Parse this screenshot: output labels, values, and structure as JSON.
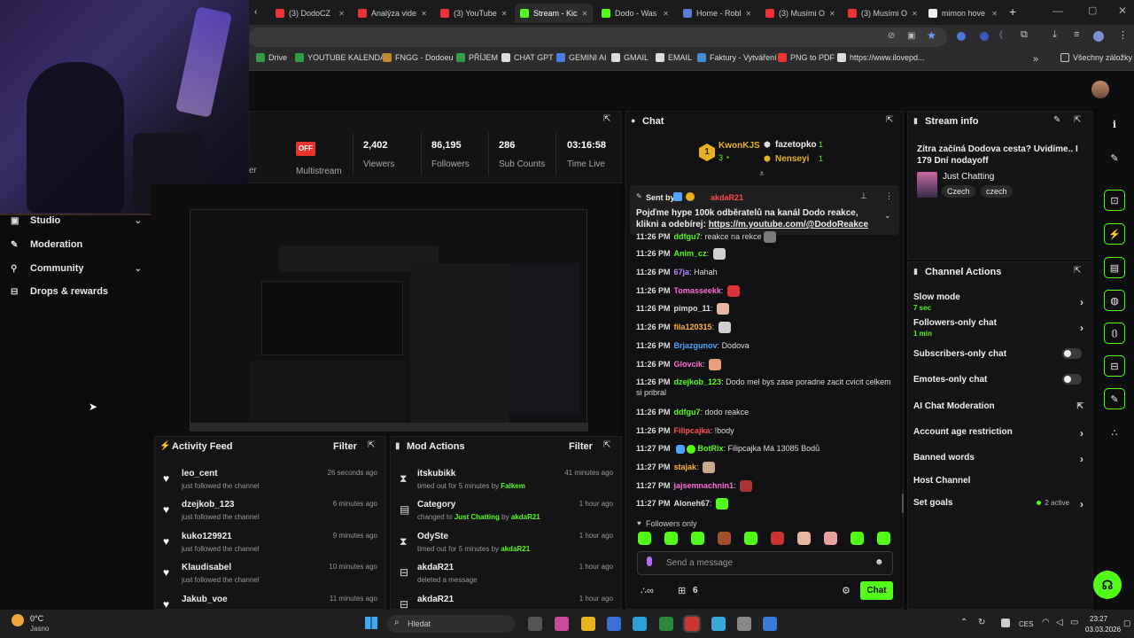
{
  "browser": {
    "tabs": [
      {
        "label": "(3) DodoCZ",
        "color": "#e33"
      },
      {
        "label": "Analýza vide",
        "color": "#e33"
      },
      {
        "label": "(3) YouTube",
        "color": "#e33"
      },
      {
        "label": "Stream - Kic",
        "color": "#53fc18",
        "active": true
      },
      {
        "label": "Dodo - Was",
        "color": "#53fc18"
      },
      {
        "label": "Home - Robl",
        "color": "#5b7bd5"
      },
      {
        "label": "(3) Musími O",
        "color": "#e33"
      },
      {
        "label": "(3) Musími O",
        "color": "#e33"
      },
      {
        "label": "mimon hove",
        "color": "#eee"
      }
    ],
    "new_tab": "+",
    "bookmarks": [
      "Drive",
      "YOUTUBE KALENDÁŘ",
      "FNGG - Dodoeu",
      "PŘÍJEM",
      "CHAT GPT",
      "GEMINI AI",
      "GMAIL",
      "EMAIL",
      "Faktury - Vytváření",
      "PNG to PDF",
      "https://www.ilovepd..."
    ],
    "more_bookmarks": "»",
    "all_bookmarks": "Všechny záložky"
  },
  "stats": {
    "badge": "OFF",
    "multistream": "Multistream",
    "partial_label": "er",
    "items": [
      {
        "value": "2,402",
        "label": "Viewers"
      },
      {
        "value": "86,195",
        "label": "Followers"
      },
      {
        "value": "286",
        "label": "Sub Counts"
      },
      {
        "value": "03:16:58",
        "label": "Time Live"
      }
    ]
  },
  "sidebar": {
    "items": [
      {
        "label": "Studio",
        "chevron": true
      },
      {
        "label": "Moderation",
        "chevron": false
      },
      {
        "label": "Community",
        "chevron": true
      },
      {
        "label": "Drops & rewards",
        "chevron": false
      }
    ]
  },
  "activity_feed": {
    "title": "Activity Feed",
    "filter": "Filter",
    "items": [
      {
        "name": "leo_cent",
        "sub": "just followed the channel",
        "time": "26 seconds ago"
      },
      {
        "name": "dzejkob_123",
        "sub": "just followed the channel",
        "time": "6 minutes ago"
      },
      {
        "name": "kuko129921",
        "sub": "just followed the channel",
        "time": "9 minutes ago"
      },
      {
        "name": "Klaudisabel",
        "sub": "just followed the channel",
        "time": "10 minutes ago"
      },
      {
        "name": "Jakub_voe",
        "sub": "",
        "time": "11 minutes ago"
      }
    ]
  },
  "mod_actions": {
    "title": "Mod Actions",
    "filter": "Filter",
    "items": [
      {
        "name": "itskubikk",
        "pre": "timed out for 5 minutes by ",
        "hl": "Falkem",
        "hl2pre": "",
        "hl2": "",
        "time": "41 minutes ago",
        "icon": "hourglass-icon"
      },
      {
        "name": "Category",
        "pre": "changed to ",
        "hl": "Just Chatting",
        "hl2pre": " by ",
        "hl2": "akdaR21",
        "time": "1 hour ago",
        "icon": "category-icon"
      },
      {
        "name": "OdySte",
        "pre": "timed out for 5 minutes by ",
        "hl": "akdaR21",
        "hl2pre": "",
        "hl2": "",
        "time": "1 hour ago",
        "icon": "hourglass-icon"
      },
      {
        "name": "akdaR21",
        "pre": "deleted a message",
        "hl": "",
        "hl2pre": "",
        "hl2": "",
        "time": "1 hour ago",
        "icon": "trash-icon"
      },
      {
        "name": "akdaR21",
        "pre": "",
        "hl": "",
        "hl2pre": "",
        "hl2": "",
        "time": "1 hour ago",
        "icon": "trash-icon"
      }
    ]
  },
  "chat": {
    "title": "Chat",
    "top_gifters": [
      {
        "rank": "1",
        "name": "KwonKJS",
        "count": "3"
      },
      {
        "rank": "",
        "name": "fazetopko",
        "count": "1"
      },
      {
        "rank": "",
        "name": "Nenseyi",
        "count": "1"
      }
    ],
    "pinned": {
      "sent_by": "Sent by",
      "user": "akdaR21",
      "text": "Pojďme hype 100k odběratelů na kanál Dodo reakce, klikni a odebírej: ",
      "link": "https://m.youtube.com/@DodoReakce"
    },
    "messages": [
      {
        "time": "11:26 PM",
        "user": "ddfgu7",
        "color": "#53fc18",
        "text": "reakce na rekce"
      },
      {
        "time": "11:26 PM",
        "user": "Anim_cz",
        "color": "#53fc18",
        "text": ""
      },
      {
        "time": "11:26 PM",
        "user": "67ja",
        "color": "#b58cff",
        "text": "Hahah"
      },
      {
        "time": "11:26 PM",
        "user": "Tomasseekk",
        "color": "#ff6bd6",
        "text": ""
      },
      {
        "time": "11:26 PM",
        "user": "pimpo_11",
        "color": "#ddd",
        "text": ""
      },
      {
        "time": "11:26 PM",
        "user": "fila120315",
        "color": "#ffb13b",
        "text": ""
      },
      {
        "time": "11:26 PM",
        "user": "Brjazgunov",
        "color": "#4da3ff",
        "text": "Dodova"
      },
      {
        "time": "11:26 PM",
        "user": "Glovcik",
        "color": "#ff6bd6",
        "text": ""
      },
      {
        "time": "11:26 PM",
        "user": "dzejkob_123",
        "color": "#53fc18",
        "text": "Dodo mel bys zase poradne zacit cvicit celkem si pribral"
      },
      {
        "time": "11:26 PM",
        "user": "ddfgu7",
        "color": "#53fc18",
        "text": "dodo reakce"
      },
      {
        "time": "11:26 PM",
        "user": "Filipcajka",
        "color": "#ff4d4d",
        "text": "!body"
      },
      {
        "time": "11:27 PM",
        "user": "BotRix",
        "color": "#53fc18",
        "text": "Filipcajka Má 13085 Bodů"
      },
      {
        "time": "11:27 PM",
        "user": "stajak",
        "color": "#ffb13b",
        "text": ""
      },
      {
        "time": "11:27 PM",
        "user": "jajsemnachnin1",
        "color": "#ff6bd6",
        "text": ""
      },
      {
        "time": "11:27 PM",
        "user": "Aloneh67",
        "color": "#ddd",
        "text": ""
      }
    ],
    "followers_only": "Followers only",
    "input_placeholder": "Send a message",
    "gift_count": "6",
    "chat_button": "Chat"
  },
  "stream_info": {
    "title": "Stream info",
    "stream_title": "Zítra začíná Dodova cesta? Uvidíme.. I 179 Dní nodayoff",
    "category": "Just Chatting",
    "tags": [
      "Czech",
      "czech"
    ]
  },
  "channel_actions": {
    "title": "Channel Actions",
    "items": [
      {
        "label": "Slow mode",
        "sub": "7 sec",
        "kind": "arrow"
      },
      {
        "label": "Followers-only chat",
        "sub": "1 min",
        "kind": "arrow"
      },
      {
        "label": "Subscribers-only chat",
        "sub": "",
        "kind": "toggle"
      },
      {
        "label": "Emotes-only chat",
        "sub": "",
        "kind": "toggle"
      },
      {
        "label": "AI Chat Moderation",
        "sub": "",
        "kind": "external"
      },
      {
        "label": "Account age restriction",
        "sub": "",
        "kind": "arrow"
      },
      {
        "label": "Banned words",
        "sub": "",
        "kind": "arrow"
      },
      {
        "label": "Host Channel",
        "sub": "",
        "kind": "none"
      },
      {
        "label": "Set goals",
        "sub": "",
        "kind": "arrow"
      }
    ],
    "goals_active": "2 active"
  },
  "taskbar": {
    "weather_temp": "0°C",
    "weather_desc": "Jasno",
    "search_placeholder": "Hledat",
    "lang": "CES",
    "time": "23:27",
    "date": "03.03.2026"
  }
}
